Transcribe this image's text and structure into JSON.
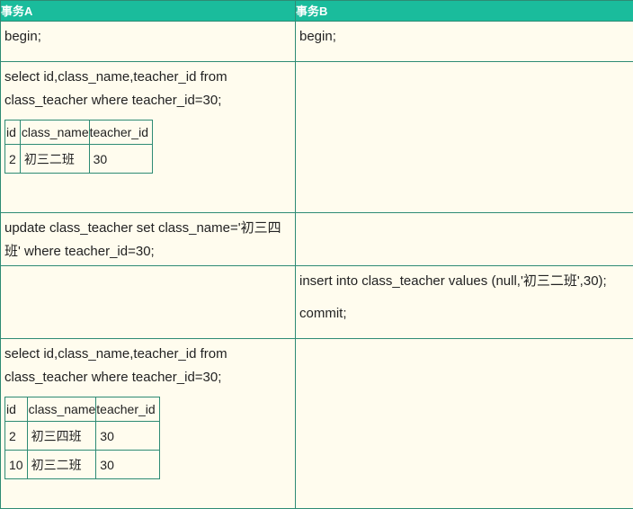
{
  "headers": [
    "事务A",
    "事务B"
  ],
  "rows": [
    {
      "a": [
        "begin;"
      ],
      "b": [
        "begin;"
      ]
    },
    {
      "a": [
        "select id,class_name,teacher_id from class_teacher where teacher_id=30;"
      ],
      "b": []
    },
    {
      "a": [
        "update class_teacher set class_name='初三四班' where teacher_id=30;"
      ],
      "b": []
    },
    {
      "a": [],
      "b": [
        "insert into class_teacher values (null,'初三二班',30);",
        "commit;"
      ]
    },
    {
      "a": [
        "select id,class_name,teacher_id from class_teacher where teacher_id=30;"
      ],
      "b": []
    }
  ],
  "result1": {
    "columns": [
      "id",
      "class_name",
      "teacher_id"
    ],
    "rows": [
      [
        "2",
        "初三二班",
        "30"
      ]
    ]
  },
  "result2": {
    "columns": [
      "id",
      "class_name",
      "teacher_id"
    ],
    "rows": [
      [
        "2",
        "初三四班",
        "30"
      ],
      [
        "10",
        "初三二班",
        "30"
      ]
    ]
  }
}
